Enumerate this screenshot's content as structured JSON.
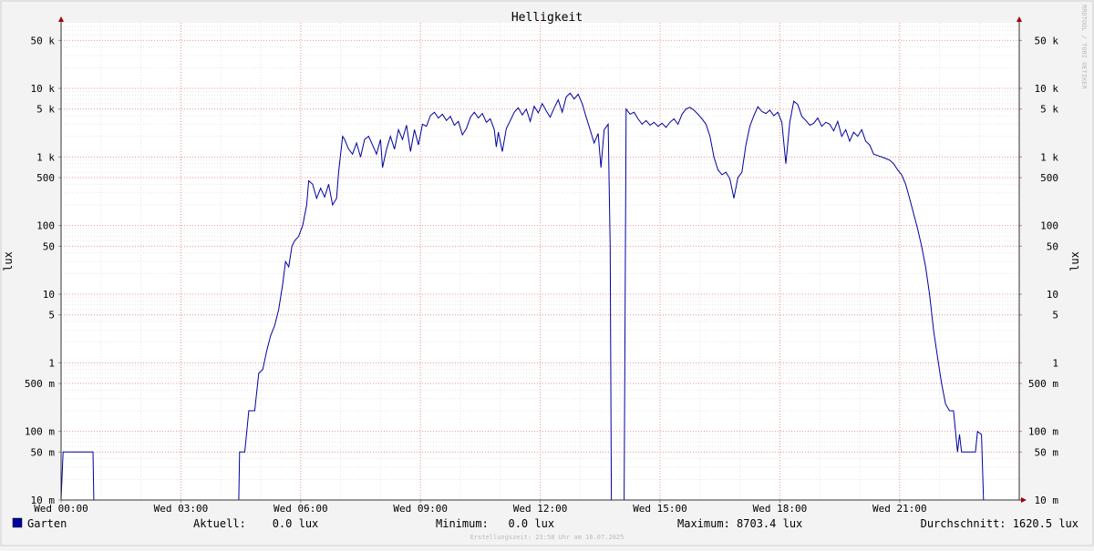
{
  "colors": {
    "background": "#f3f3f3",
    "canvas": "#ffffff",
    "grid_minor": "#e6e6e6",
    "grid_major": "#e89a9a",
    "series": "#0000a0",
    "axis_arrow": "#a00000"
  },
  "chart_data": {
    "type": "line",
    "title": "Helligkeit",
    "ylabel": "lux",
    "ylabel_right": "lux",
    "yscale": "log",
    "ylim": [
      0.01,
      80000
    ],
    "xlim_hours": [
      0,
      24
    ],
    "x_unit": "hours since Wed 00:00",
    "x_ticks": [
      {
        "value": 0,
        "label": "Wed 00:00"
      },
      {
        "value": 3,
        "label": "Wed 03:00"
      },
      {
        "value": 6,
        "label": "Wed 06:00"
      },
      {
        "value": 9,
        "label": "Wed 09:00"
      },
      {
        "value": 12,
        "label": "Wed 12:00"
      },
      {
        "value": 15,
        "label": "Wed 15:00"
      },
      {
        "value": 18,
        "label": "Wed 18:00"
      },
      {
        "value": 21,
        "label": "Wed 21:00"
      }
    ],
    "y_ticks": [
      {
        "value": 50000,
        "label": "50 k"
      },
      {
        "value": 10000,
        "label": "10 k"
      },
      {
        "value": 5000,
        "label": "5 k"
      },
      {
        "value": 1000,
        "label": "1 k"
      },
      {
        "value": 500,
        "label": "500"
      },
      {
        "value": 100,
        "label": "100"
      },
      {
        "value": 50,
        "label": "50"
      },
      {
        "value": 10,
        "label": "10"
      },
      {
        "value": 5,
        "label": "5"
      },
      {
        "value": 1,
        "label": "1"
      },
      {
        "value": 0.5,
        "label": "500 m"
      },
      {
        "value": 0.1,
        "label": "100 m"
      },
      {
        "value": 0.05,
        "label": "50 m"
      },
      {
        "value": 0.01,
        "label": "10 m"
      }
    ],
    "grid": true,
    "legend_position": "bottom-left",
    "series": [
      {
        "name": "Garten",
        "points": [
          [
            0.0,
            0.01
          ],
          [
            0.05,
            0.05
          ],
          [
            0.8,
            0.05
          ],
          [
            0.82,
            0.01
          ],
          [
            4.45,
            0.01
          ],
          [
            4.47,
            0.05
          ],
          [
            4.6,
            0.05
          ],
          [
            4.7,
            0.2
          ],
          [
            4.85,
            0.2
          ],
          [
            4.95,
            0.7
          ],
          [
            5.05,
            0.8
          ],
          [
            5.15,
            1.5
          ],
          [
            5.25,
            2.5
          ],
          [
            5.35,
            3.5
          ],
          [
            5.45,
            6
          ],
          [
            5.55,
            14
          ],
          [
            5.62,
            30
          ],
          [
            5.7,
            25
          ],
          [
            5.78,
            50
          ],
          [
            5.85,
            60
          ],
          [
            5.95,
            70
          ],
          [
            6.05,
            100
          ],
          [
            6.15,
            200
          ],
          [
            6.2,
            450
          ],
          [
            6.3,
            400
          ],
          [
            6.4,
            250
          ],
          [
            6.5,
            350
          ],
          [
            6.6,
            260
          ],
          [
            6.7,
            400
          ],
          [
            6.8,
            200
          ],
          [
            6.9,
            250
          ],
          [
            6.95,
            600
          ],
          [
            7.05,
            2000
          ],
          [
            7.1,
            1800
          ],
          [
            7.2,
            1300
          ],
          [
            7.3,
            1100
          ],
          [
            7.4,
            1600
          ],
          [
            7.5,
            1000
          ],
          [
            7.6,
            1800
          ],
          [
            7.7,
            2000
          ],
          [
            7.8,
            1500
          ],
          [
            7.9,
            1100
          ],
          [
            8.0,
            1800
          ],
          [
            8.05,
            700
          ],
          [
            8.15,
            1300
          ],
          [
            8.25,
            2000
          ],
          [
            8.35,
            1300
          ],
          [
            8.45,
            2500
          ],
          [
            8.55,
            1800
          ],
          [
            8.65,
            2900
          ],
          [
            8.75,
            1200
          ],
          [
            8.85,
            2500
          ],
          [
            8.95,
            1500
          ],
          [
            9.05,
            3000
          ],
          [
            9.15,
            2800
          ],
          [
            9.25,
            4000
          ],
          [
            9.35,
            4500
          ],
          [
            9.45,
            3700
          ],
          [
            9.55,
            4200
          ],
          [
            9.65,
            3400
          ],
          [
            9.75,
            3900
          ],
          [
            9.85,
            2900
          ],
          [
            9.95,
            3300
          ],
          [
            10.05,
            2100
          ],
          [
            10.15,
            2600
          ],
          [
            10.25,
            3800
          ],
          [
            10.35,
            4500
          ],
          [
            10.45,
            3700
          ],
          [
            10.55,
            4300
          ],
          [
            10.65,
            3200
          ],
          [
            10.75,
            3600
          ],
          [
            10.85,
            2500
          ],
          [
            10.9,
            1400
          ],
          [
            10.95,
            2300
          ],
          [
            11.05,
            1200
          ],
          [
            11.15,
            2600
          ],
          [
            11.25,
            3400
          ],
          [
            11.35,
            4500
          ],
          [
            11.45,
            5200
          ],
          [
            11.55,
            4100
          ],
          [
            11.65,
            5000
          ],
          [
            11.75,
            3300
          ],
          [
            11.85,
            5500
          ],
          [
            11.95,
            4400
          ],
          [
            12.05,
            6000
          ],
          [
            12.15,
            4700
          ],
          [
            12.25,
            3800
          ],
          [
            12.35,
            5200
          ],
          [
            12.45,
            6800
          ],
          [
            12.55,
            4500
          ],
          [
            12.65,
            7500
          ],
          [
            12.75,
            8500
          ],
          [
            12.85,
            7000
          ],
          [
            12.95,
            8200
          ],
          [
            13.05,
            6000
          ],
          [
            13.15,
            3800
          ],
          [
            13.25,
            2500
          ],
          [
            13.35,
            1600
          ],
          [
            13.45,
            2200
          ],
          [
            13.52,
            700
          ],
          [
            13.6,
            2500
          ],
          [
            13.7,
            3000
          ],
          [
            13.75,
            50
          ],
          [
            13.78,
            0.01
          ],
          [
            14.1,
            0.01
          ],
          [
            14.15,
            5000
          ],
          [
            14.25,
            4200
          ],
          [
            14.35,
            4500
          ],
          [
            14.45,
            3600
          ],
          [
            14.55,
            3000
          ],
          [
            14.65,
            3400
          ],
          [
            14.75,
            2900
          ],
          [
            14.85,
            3200
          ],
          [
            14.95,
            2800
          ],
          [
            15.05,
            3100
          ],
          [
            15.15,
            2700
          ],
          [
            15.25,
            3200
          ],
          [
            15.35,
            3600
          ],
          [
            15.45,
            3000
          ],
          [
            15.55,
            4200
          ],
          [
            15.65,
            5000
          ],
          [
            15.75,
            5300
          ],
          [
            15.85,
            4800
          ],
          [
            15.95,
            4200
          ],
          [
            16.05,
            3600
          ],
          [
            16.15,
            3000
          ],
          [
            16.25,
            2000
          ],
          [
            16.35,
            1000
          ],
          [
            16.45,
            650
          ],
          [
            16.55,
            550
          ],
          [
            16.65,
            600
          ],
          [
            16.75,
            480
          ],
          [
            16.85,
            250
          ],
          [
            16.95,
            500
          ],
          [
            17.05,
            600
          ],
          [
            17.15,
            1500
          ],
          [
            17.25,
            2800
          ],
          [
            17.35,
            4000
          ],
          [
            17.45,
            5400
          ],
          [
            17.55,
            4600
          ],
          [
            17.65,
            4300
          ],
          [
            17.75,
            4800
          ],
          [
            17.85,
            4000
          ],
          [
            17.95,
            4500
          ],
          [
            18.05,
            3200
          ],
          [
            18.15,
            800
          ],
          [
            18.25,
            3200
          ],
          [
            18.35,
            6500
          ],
          [
            18.45,
            5800
          ],
          [
            18.55,
            3900
          ],
          [
            18.65,
            3400
          ],
          [
            18.75,
            2900
          ],
          [
            18.85,
            3100
          ],
          [
            18.95,
            3700
          ],
          [
            19.05,
            2800
          ],
          [
            19.15,
            3200
          ],
          [
            19.25,
            3000
          ],
          [
            19.35,
            2400
          ],
          [
            19.45,
            3300
          ],
          [
            19.55,
            2000
          ],
          [
            19.65,
            2500
          ],
          [
            19.75,
            1700
          ],
          [
            19.85,
            2300
          ],
          [
            19.95,
            2000
          ],
          [
            20.05,
            2500
          ],
          [
            20.15,
            1700
          ],
          [
            20.25,
            1500
          ],
          [
            20.35,
            1100
          ],
          [
            20.45,
            1050
          ],
          [
            20.55,
            1000
          ],
          [
            20.65,
            950
          ],
          [
            20.75,
            900
          ],
          [
            20.85,
            800
          ],
          [
            20.95,
            650
          ],
          [
            21.05,
            550
          ],
          [
            21.15,
            400
          ],
          [
            21.25,
            250
          ],
          [
            21.35,
            150
          ],
          [
            21.45,
            90
          ],
          [
            21.55,
            50
          ],
          [
            21.65,
            25
          ],
          [
            21.75,
            10
          ],
          [
            21.85,
            3
          ],
          [
            21.95,
            1.2
          ],
          [
            22.05,
            0.5
          ],
          [
            22.15,
            0.25
          ],
          [
            22.25,
            0.2
          ],
          [
            22.35,
            0.2
          ],
          [
            22.4,
            0.1
          ],
          [
            22.45,
            0.05
          ],
          [
            22.5,
            0.09
          ],
          [
            22.55,
            0.05
          ],
          [
            22.9,
            0.05
          ],
          [
            22.95,
            0.1
          ],
          [
            23.05,
            0.09
          ],
          [
            23.1,
            0.01
          ],
          [
            23.7,
            0.01
          ]
        ]
      }
    ]
  },
  "legend": {
    "series_name": "Garten",
    "current": "Aktuell:    0.0 lux",
    "minimum": "Minimum:   0.0 lux",
    "maximum": "Maximum: 8703.4 lux",
    "average": "Durchschnitt: 1620.5 lux"
  },
  "footer": {
    "created": "Erstellungszeit: 23:58 Uhr am 16.07.2025"
  },
  "watermark": "RRDTOOL / TOBI OETIKER"
}
